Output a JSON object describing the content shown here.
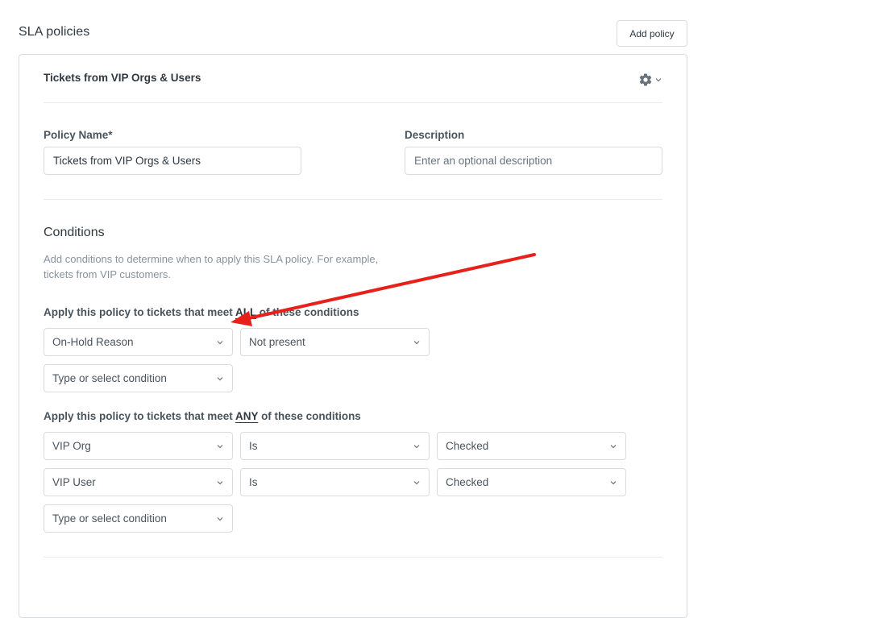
{
  "header": {
    "title": "SLA policies",
    "add_policy_label": "Add policy"
  },
  "policy": {
    "title": "Tickets from VIP Orgs & Users",
    "settings_icon": "gear-icon",
    "name_label": "Policy Name*",
    "name_value": "Tickets from VIP Orgs & Users",
    "description_label": "Description",
    "description_placeholder": "Enter an optional description"
  },
  "conditions": {
    "title": "Conditions",
    "helper_line1": "Add conditions to determine when to apply this SLA policy. For example,",
    "helper_line2": "tickets from VIP customers.",
    "all": {
      "label_prefix": "Apply this policy to tickets that meet ",
      "keyword": "ALL",
      "label_suffix": " of these conditions",
      "rows": [
        {
          "field": "On-Hold Reason",
          "operator": "Not present"
        }
      ],
      "add_placeholder": "Type or select condition"
    },
    "any": {
      "label_prefix": "Apply this policy to tickets that meet ",
      "keyword": "ANY",
      "label_suffix": " of these conditions",
      "rows": [
        {
          "field": "VIP Org",
          "operator": "Is",
          "value": "Checked"
        },
        {
          "field": "VIP User",
          "operator": "Is",
          "value": "Checked"
        }
      ],
      "add_placeholder": "Type or select condition"
    }
  },
  "annotation": {
    "color": "#e8201c"
  }
}
